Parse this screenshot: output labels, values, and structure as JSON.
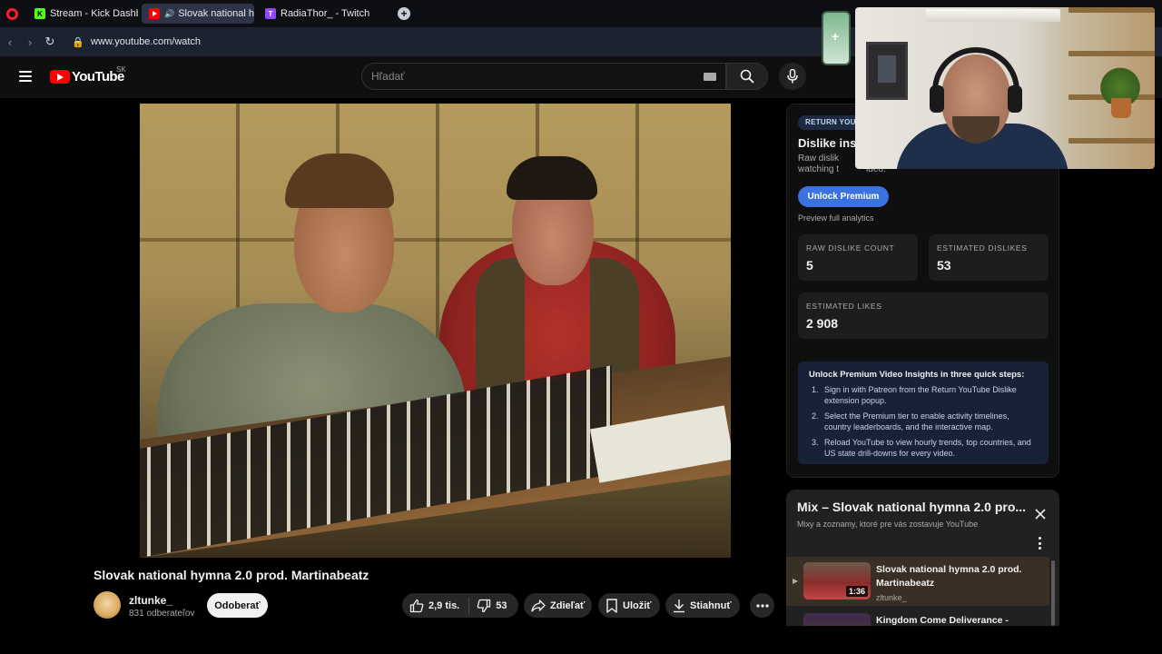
{
  "browser": {
    "tabs": [
      {
        "label": "Stream - Kick Dashboard",
        "icon": "kick-icon",
        "favicon_color": "#53fc18",
        "active": false
      },
      {
        "label": "Slovak national hymn...",
        "icon": "youtube-icon",
        "favicon_color": "#ff0000",
        "active": true,
        "audio": true
      },
      {
        "label": "RadiaThor_ - Twitch",
        "icon": "twitch-icon",
        "favicon_color": "#9146ff",
        "active": false
      }
    ],
    "new_tab": "+",
    "url": "www.youtube.com/watch"
  },
  "youtube": {
    "logo": "YouTube",
    "region": "SK",
    "search_placeholder": "Hľadať"
  },
  "video": {
    "title": "Slovak national hymna 2.0 prod. Martinabeatz",
    "channel": "zltunke_",
    "subscribers": "831 odberateľov",
    "subscribe_label": "Odoberať",
    "likes": "2,9 tis.",
    "dislikes": "53",
    "share_label": "Zdieľať",
    "save_label": "Uložiť",
    "download_label": "Stiahnuť"
  },
  "ryd": {
    "badge": "RETURN YOU",
    "title": "Dislike ins",
    "desc_line1": "Raw dislik",
    "desc_line2": "watching t",
    "desc_line2_end": "ideo.",
    "unlock_label": "Unlock Premium",
    "preview_label": "Preview full analytics",
    "raw_dislike_label": "RAW DISLIKE COUNT",
    "raw_dislike_value": "5",
    "est_dislikes_label": "ESTIMATED DISLIKES",
    "est_dislikes_value": "53",
    "est_likes_label": "ESTIMATED LIKES",
    "est_likes_value": "2 908",
    "steps_heading": "Unlock Premium Video Insights in three quick steps:",
    "steps": [
      "Sign in with Patreon from the Return YouTube Dislike extension popup.",
      "Select the Premium tier to enable activity timelines, country leaderboards, and the interactive map.",
      "Reload YouTube to view hourly trends, top countries, and US state drill-downs for every video."
    ]
  },
  "mix": {
    "title": "Mix – Slovak national hymna 2.0 pro...",
    "subtitle": "Mixy a zoznamy, ktoré pre vás zostavuje YouTube",
    "items": [
      {
        "title": "Slovak national hymna 2.0 prod. Martinabeatz",
        "channel": "zltunke_",
        "duration": "1:36",
        "playing": true
      },
      {
        "title": "Kingdom Come Deliverance -",
        "channel": "",
        "duration": "",
        "playing": false
      }
    ]
  },
  "colors": {
    "youtube_red": "#ff0000",
    "premium_blue": "#3a72e0",
    "page_bg": "#0f0f0f"
  }
}
